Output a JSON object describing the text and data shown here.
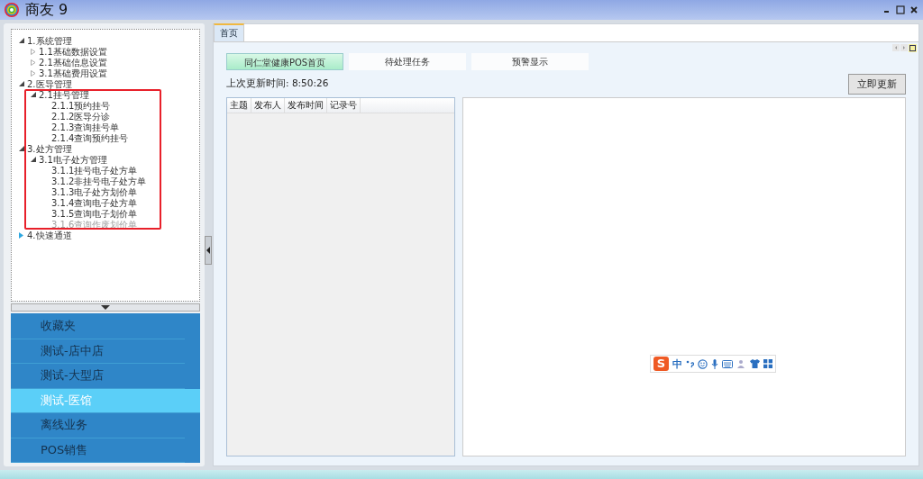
{
  "window": {
    "title": "商友 9"
  },
  "tree": [
    {
      "label": "1.系统管理",
      "expanded": true,
      "children": [
        {
          "label": "1.1基础数据设置",
          "expanded": false
        },
        {
          "label": "2.1基础信息设置",
          "expanded": false
        },
        {
          "label": "3.1基础费用设置",
          "expanded": false
        }
      ]
    },
    {
      "label": "2.医导管理",
      "expanded": true,
      "children": [
        {
          "label": "2.1挂号管理",
          "expanded": true,
          "children": [
            {
              "label": "2.1.1预约挂号",
              "disabled": false
            },
            {
              "label": "2.1.2医导分诊",
              "disabled": false
            },
            {
              "label": "2.1.3查询挂号单",
              "disabled": false
            },
            {
              "label": "2.1.4查询预约挂号",
              "disabled": false
            }
          ]
        }
      ]
    },
    {
      "label": "3.处方管理",
      "expanded": true,
      "children": [
        {
          "label": "3.1电子处方管理",
          "expanded": true,
          "children": [
            {
              "label": "3.1.1挂号电子处方单",
              "disabled": false
            },
            {
              "label": "3.1.2非挂号电子处方单",
              "disabled": false
            },
            {
              "label": "3.1.3电子处方划价单",
              "disabled": false
            },
            {
              "label": "3.1.4查询电子处方单",
              "disabled": false
            },
            {
              "label": "3.1.5查询电子划价单",
              "disabled": false
            },
            {
              "label": "3.1.6查询作废划价单",
              "disabled": true
            }
          ]
        }
      ]
    },
    {
      "label": "4.快速通道",
      "expanded": false
    }
  ],
  "nav": [
    {
      "label": "收藏夹",
      "selected": false
    },
    {
      "label": "测试-店中店",
      "selected": false
    },
    {
      "label": "测试-大型店",
      "selected": false
    },
    {
      "label": "测试-医馆",
      "selected": true
    },
    {
      "label": "离线业务",
      "selected": false
    },
    {
      "label": "POS销售",
      "selected": false
    }
  ],
  "tabs": [
    {
      "label": "首页",
      "selected": true
    }
  ],
  "sub_tabs": [
    {
      "label": "同仁堂健康POS首页",
      "selected": true
    },
    {
      "label": "待处理任务",
      "selected": false
    },
    {
      "label": "预警显示",
      "selected": false
    }
  ],
  "last_update": "上次更新时间: 8:50:26",
  "refresh_button": "立即更新",
  "table": {
    "columns": [
      "主题",
      "发布人",
      "发布时间",
      "记录号"
    ]
  },
  "ime_toolbar": {
    "logo": "S",
    "mode": "中"
  }
}
